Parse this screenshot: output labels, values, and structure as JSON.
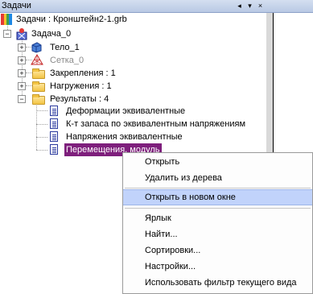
{
  "panel": {
    "title": "Задачи",
    "controls": {
      "pin": "◂",
      "dropdown": "▾",
      "close": "×"
    }
  },
  "tree": {
    "root_label": "Задачи : Кронштейн2-1.grb",
    "task_label": "Задача_0",
    "body_label": "Тело_1",
    "mesh_label": "Сетка_0",
    "constraints_label": "Закрепления : 1",
    "loads_label": "Нагружения : 1",
    "results_label": "Результаты : 4",
    "result_items": [
      "Деформации эквивалентные",
      "К-т запаса по эквивалентным напряжениям",
      "Напряжения эквивалентные",
      "Перемещения, модуль"
    ],
    "expand_minus": "−",
    "expand_plus": "+"
  },
  "context_menu": {
    "items": [
      "Открыть",
      "Удалить из дерева",
      "Открыть в новом окне",
      "Ярлык",
      "Найти...",
      "Сортировки...",
      "Настройки...",
      "Использовать фильтр текущего вида"
    ],
    "highlighted_index": 2
  },
  "colors": {
    "selection": "#7e1f7c",
    "menu_highlight": "#c1d3fb",
    "mesh_text": "#8a8a8a"
  }
}
